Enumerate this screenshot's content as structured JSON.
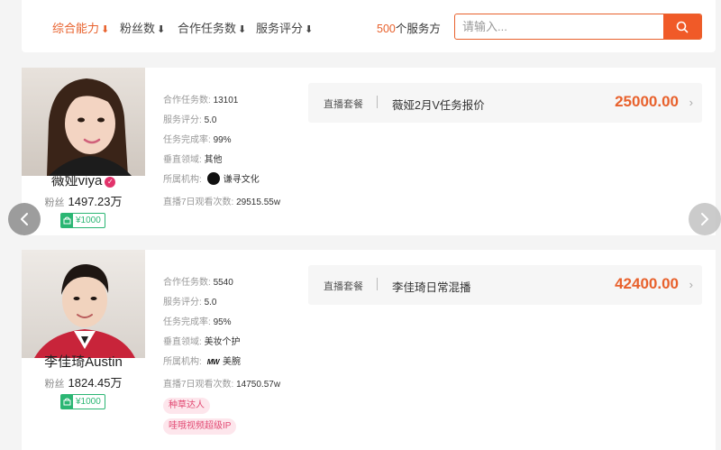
{
  "filters": {
    "sort_options": [
      {
        "label": "综合能力",
        "arrow": "⬇"
      },
      {
        "label": "粉丝数",
        "arrow": "⬇"
      },
      {
        "label": "合作任务数",
        "arrow": "⬇"
      },
      {
        "label": "服务评分",
        "arrow": "⬇"
      }
    ],
    "provider_count": "500",
    "provider_suffix": "个服务方",
    "search_placeholder": "请输入...",
    "accent_color": "#e8612c"
  },
  "influencers": [
    {
      "name": "薇娅viya",
      "verified_icon": "verified-badge-icon",
      "fans_label": "粉丝",
      "fans_value": "1497.23万",
      "price_tag": "¥1000",
      "stats": [
        {
          "label": "合作任务数:",
          "value": "13101"
        },
        {
          "label": "服务评分:",
          "value": "5.0"
        },
        {
          "label": "任务完成率:",
          "value": "99%"
        },
        {
          "label": "垂直领域:",
          "value": "其他"
        },
        {
          "label": "所属机构:",
          "value": "谦寻文化"
        },
        {
          "label": "直播7日观看次数:",
          "value": "29515.55w"
        }
      ],
      "tags": [],
      "package": {
        "type": "直播套餐",
        "name": "薇娅2月V任务报价",
        "price": "25000.00"
      }
    },
    {
      "name": "李佳琦Austin",
      "fans_label": "粉丝",
      "fans_value": "1824.45万",
      "price_tag": "¥1000",
      "stats": [
        {
          "label": "合作任务数:",
          "value": "5540"
        },
        {
          "label": "服务评分:",
          "value": "5.0"
        },
        {
          "label": "任务完成率:",
          "value": "95%"
        },
        {
          "label": "垂直领域:",
          "value": "美妆个护"
        },
        {
          "label": "所属机构:",
          "value": "美腕",
          "logo_text": "MW"
        },
        {
          "label": "直播7日观看次数:",
          "value": "14750.57w"
        }
      ],
      "tags": [
        "种草达人",
        "哇哦视频超级IP"
      ],
      "package": {
        "type": "直播套餐",
        "name": "李佳琦日常混播",
        "price": "42400.00"
      }
    }
  ]
}
